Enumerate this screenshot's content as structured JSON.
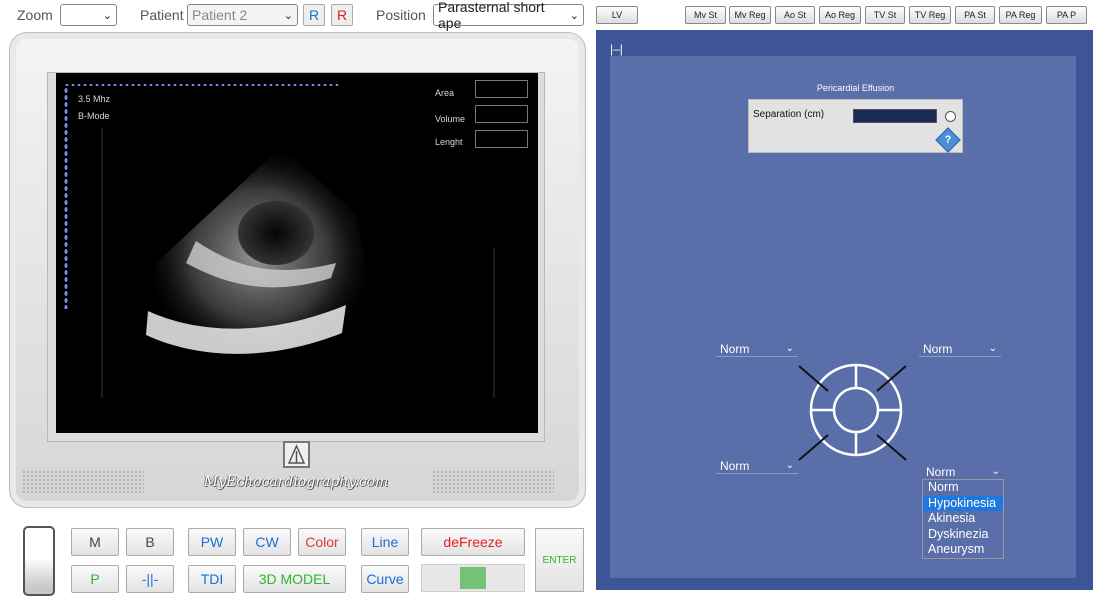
{
  "toolbar": {
    "zoom_label": "Zoom",
    "zoom_value": "",
    "patient_label": "Patient",
    "patient_value": "Patient 2",
    "r_button_1": "R",
    "r_button_2": "R",
    "position_label": "Position",
    "position_value": "Parasternal short ape",
    "lv_button": "LV",
    "valve_buttons": [
      "Mv St",
      "Mv Reg",
      "Ao St",
      "Ao Reg",
      "TV St",
      "TV Reg",
      "PA St",
      "PA Reg",
      "PA P"
    ]
  },
  "screen": {
    "frequency": "3.5 Mhz",
    "mode": "B-Mode",
    "area_label": "Area",
    "volume_label": "Volume",
    "length_label": "Lenght"
  },
  "monitor": {
    "brand": "MyEchocardiography.com"
  },
  "controls": {
    "m": "M",
    "b": "B",
    "p": "P",
    "caliper": "-||-",
    "pw": "PW",
    "cw": "CW",
    "color": "Color",
    "tdi": "TDI",
    "model_3d": "3D MODEL",
    "line": "Line",
    "curve": "Curve",
    "defreeze": "deFreeze",
    "enter": "ENTER"
  },
  "right_panel": {
    "corner": "|–|",
    "pericardial_title": "Pericardial Effusion",
    "separation_label": "Separation (cm)",
    "help_icon": "?",
    "wall_top_left": "Norm",
    "wall_top_right": "Norm",
    "wall_bottom_left": "Norm",
    "wall_bottom_right": "Norm",
    "dropdown_options": [
      "Norm",
      "Hypokinesia",
      "Akinesia",
      "Dyskinezia",
      "Aneurysm"
    ],
    "dropdown_selected": "Hypokinesia"
  },
  "colors": {
    "panel_dark": "#3d5597",
    "panel_inner": "#5a6ea9",
    "accent_blue": "#1a6fd6",
    "accent_red": "#e02020",
    "accent_green": "#2bb82b"
  }
}
